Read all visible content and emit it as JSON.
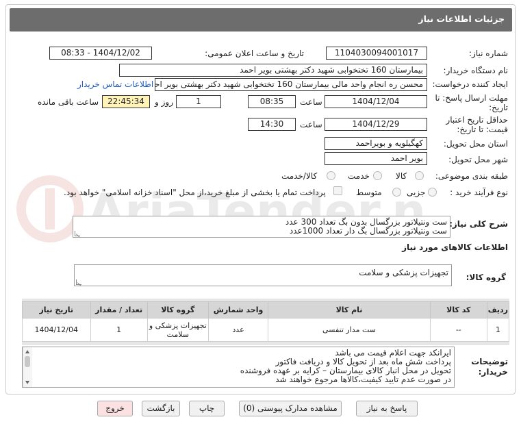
{
  "header": {
    "title": "جزئیات اطلاعات نیاز"
  },
  "fields": {
    "need_number_label": "شماره نیاز:",
    "need_number": "1104030094001017",
    "announce_label": "تاریخ و ساعت اعلان عمومی:",
    "announce_value": "1404/12/02 - 08:33",
    "buyer_org_label": "نام دستگاه خریدار:",
    "buyer_org": "بیمارستان 160 تختخوابی شهید دکتر بهشتی بویر احمد",
    "requester_label": "ایجاد کننده درخواست:",
    "requester": "محسن ره انجام واحد مالی بیمارستان 160 تختخوابی شهید دکتر بهشتی بویر احمد",
    "contact_link": "اطلاعات تماس خریدار",
    "reply_deadline_label_1": "مهلت ارسال پاسخ: تا",
    "reply_deadline_label_2": "تاریخ:",
    "reply_date": "1404/12/04",
    "time_label": "ساعت",
    "reply_time": "08:35",
    "days_value": "1",
    "days_label": "روز و",
    "remaining_time": "22:45:34",
    "remaining_label": "ساعت باقی مانده",
    "validity_label_1": "حداقل تاریخ اعتبار",
    "validity_label_2": "قیمت: تا تاریخ:",
    "validity_date": "1404/12/29",
    "validity_time_label": "ساعت",
    "validity_time": "14:30",
    "province_label": "استان محل تحویل:",
    "province": "کهگیلویه و بویراحمد",
    "city_label": "شهر محل تحویل:",
    "city": "بویر احمد",
    "category_label": "طبقه بندی موضوعی:",
    "category_options": [
      "کالا",
      "خدمت",
      "کالا/خدمت"
    ],
    "process_label": "نوع فرآیند خرید :",
    "process_options": [
      "جزیی",
      "متوسط"
    ],
    "payment_note": "پرداخت تمام یا بخشی از مبلغ خرید،از محل \"اسناد خزانه اسلامی\" خواهد بود."
  },
  "summary": {
    "label": "شرح کلی نیاز:",
    "line1": "ست ونتیلاتور بزرگسال بدون بگ تعداد 300 عدد",
    "line2": "ست ونتیلاتور بزرگسال بگ دار تعداد 1000عدد"
  },
  "goods_info_title": "اطلاعات کالاهای مورد نیاز",
  "goods_group": {
    "label": "گروه کالا:",
    "value": "تجهیزات پزشکی و سلامت"
  },
  "table": {
    "headers": [
      "ردیف",
      "کد کالا",
      "نام کالا",
      "واحد شمارش",
      "گروه کالا",
      "تعداد / مقدار",
      "تاریخ نیاز"
    ],
    "rows": [
      [
        "1",
        "--",
        "ست مدار تنفسی",
        "عدد",
        "تجهیزات پزشکی و سلامت",
        "1",
        "1404/12/04"
      ]
    ]
  },
  "buyer_notes": {
    "label_1": "توضیحات",
    "label_2": "خریدار:",
    "lines": [
      "ایرانکد جهت اعلام قیمت می باشد",
      "پرداخت شش ماه بعد از تحویل کالا و دریافت فاکتور",
      "تحویل در محل انبار کالای بیمارستان – کرایه بر عهده فروشنده",
      "در صورت عدم تایید کیفیت،کالاها مرجوع خواهند شد"
    ]
  },
  "buttons": {
    "reply": "پاسخ به نیاز",
    "attachments": "مشاهده مدارک پیوستی (0)",
    "print": "چاپ",
    "back": "بازگشت",
    "exit": "خروج"
  },
  "watermark": "AriaTender.net",
  "colors": {
    "header_bg": "#6d6d6d",
    "link": "#1f5db8",
    "remaining_bg": "#fff3b8",
    "exit_bg": "#fbe1e1"
  }
}
